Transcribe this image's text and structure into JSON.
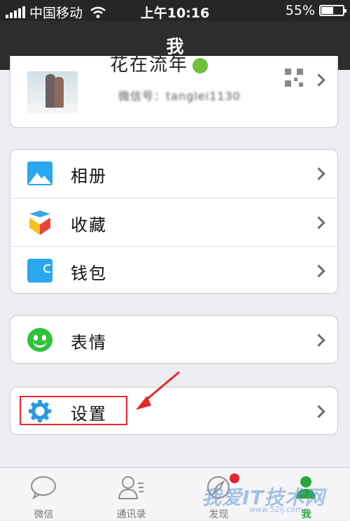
{
  "status_bar": {
    "carrier": "中国移动",
    "time": "上午10:16",
    "battery_percent": "55%",
    "battery_level": 0.55
  },
  "nav": {
    "title": "我"
  },
  "profile": {
    "name": "花在流年",
    "wechat_id": "微信号：tanglei1130"
  },
  "menu_group_1": [
    {
      "label": "相册",
      "icon": "album-icon"
    },
    {
      "label": "收藏",
      "icon": "favorites-icon"
    },
    {
      "label": "钱包",
      "icon": "wallet-icon"
    }
  ],
  "menu_group_2": [
    {
      "label": "表情",
      "icon": "emoji-icon"
    }
  ],
  "menu_group_3": [
    {
      "label": "设置",
      "icon": "gear-icon"
    }
  ],
  "tabs": [
    {
      "label": "微信",
      "icon": "chat-bubble-icon"
    },
    {
      "label": "通讯录",
      "icon": "contacts-icon"
    },
    {
      "label": "发现",
      "icon": "compass-icon"
    },
    {
      "label": "我",
      "icon": "me-icon"
    }
  ],
  "watermark": {
    "text": "我爱IT技术网",
    "url_text": "www.52ij.com"
  },
  "colors": {
    "nav_bg": "#2b2d2f",
    "accent_green": "#2aa63a",
    "highlight_red": "#e8262c",
    "icon_blue": "#29a7f0"
  }
}
